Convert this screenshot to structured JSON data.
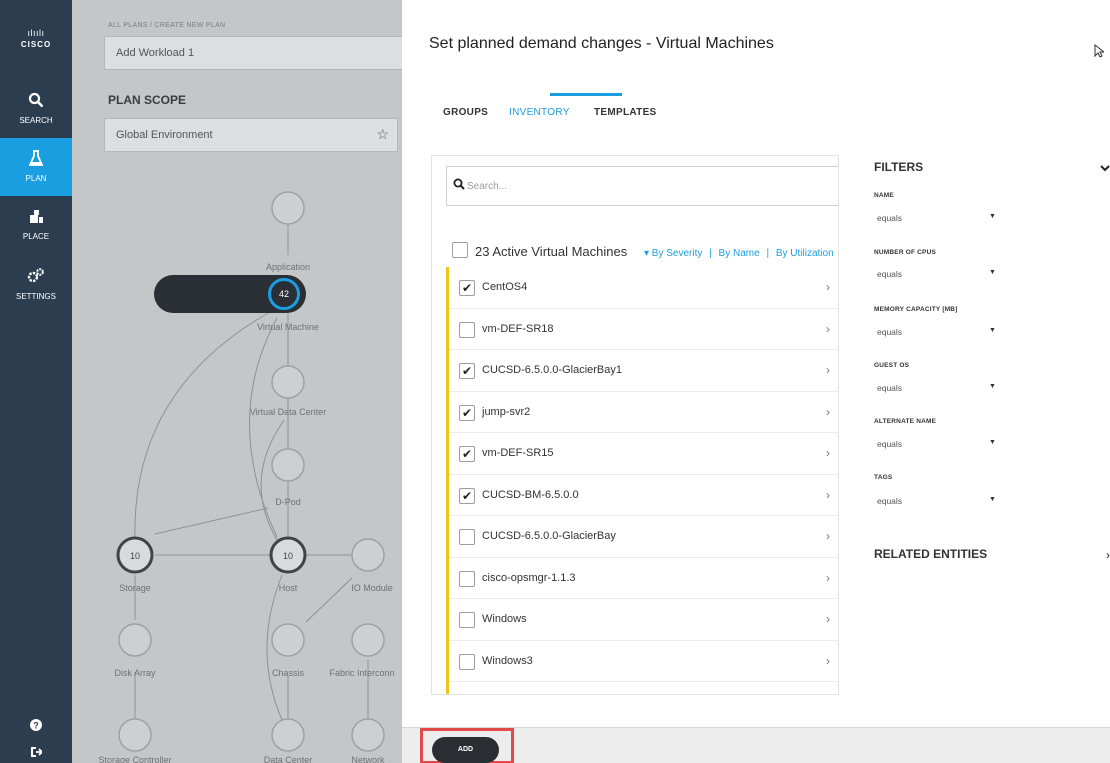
{
  "nav": {
    "logo_text": "CISCO",
    "items": [
      {
        "label": "SEARCH",
        "icon": "search-icon"
      },
      {
        "label": "PLAN",
        "icon": "flask-icon"
      },
      {
        "label": "PLACE",
        "icon": "place-icon"
      },
      {
        "label": "SETTINGS",
        "icon": "gear-icon"
      }
    ],
    "active_item": "PLAN",
    "bottom_icons": [
      "help-icon",
      "logout-icon"
    ]
  },
  "background": {
    "breadcrumb": "ALL PLANS / CREATE NEW PLAN",
    "plan_name": "Add Workload 1",
    "plan_scope_title": "PLAN SCOPE",
    "scope_value": "Global Environment",
    "graph": {
      "virtual_machine_count": "42",
      "storage_count": "10",
      "host_count": "10",
      "nodes": {
        "application": "Application",
        "virtual_machine": "Virtual Machine",
        "virtual_data_center": "Virtual Data Center",
        "d_pod": "D-Pod",
        "storage": "Storage",
        "host": "Host",
        "io_module": "IO Module",
        "disk_array": "Disk Array",
        "chassis": "Chassis",
        "fabric_interconnect": "Fabric Interconn",
        "storage_controller": "Storage Controller",
        "data_center": "Data Center",
        "network": "Network"
      }
    }
  },
  "modal": {
    "title": "Set planned demand changes - Virtual Machines",
    "tabs": [
      "GROUPS",
      "INVENTORY",
      "TEMPLATES"
    ],
    "active_tab": "INVENTORY",
    "search_placeholder": "Search...",
    "sort": {
      "by_severity": "▾ By Severity",
      "separator": "|",
      "by_name": "By Name",
      "by_utilization": "By Utilization"
    },
    "select_all_label": "23 Active Virtual Machines",
    "items": [
      {
        "name": "CentOS4",
        "checked": true
      },
      {
        "name": "vm-DEF-SR18",
        "checked": false
      },
      {
        "name": "CUCSD-6.5.0.0-GlacierBay1",
        "checked": true
      },
      {
        "name": "jump-svr2",
        "checked": true
      },
      {
        "name": "vm-DEF-SR15",
        "checked": true
      },
      {
        "name": "CUCSD-BM-6.5.0.0",
        "checked": true
      },
      {
        "name": "CUCSD-6.5.0.0-GlacierBay",
        "checked": false
      },
      {
        "name": "cisco-opsmgr-1.1.3",
        "checked": false
      },
      {
        "name": "Windows",
        "checked": false
      },
      {
        "name": "Windows3",
        "checked": false
      }
    ],
    "filters": {
      "title": "FILTERS",
      "fields": [
        {
          "label": "NAME",
          "value": "equals"
        },
        {
          "label": "NUMBER OF CPUS",
          "value": "equals"
        },
        {
          "label": "MEMORY CAPACITY [MB]",
          "value": "equals"
        },
        {
          "label": "GUEST OS",
          "value": "equals"
        },
        {
          "label": "ALTERNATE NAME",
          "value": "equals"
        },
        {
          "label": "TAGS",
          "value": "equals"
        }
      ]
    },
    "related_entities": "RELATED ENTITIES",
    "add_button": "ADD"
  },
  "colors": {
    "nav_bg": "#2b3d4f",
    "accent": "#1b9ee0",
    "list_marker": "#f0c419",
    "highlight": "#e24a4a",
    "button_dark": "#2a2e33"
  }
}
